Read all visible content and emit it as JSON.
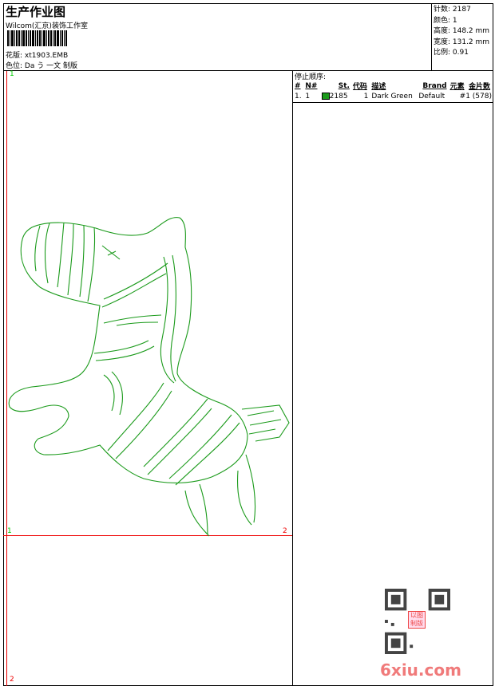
{
  "header": {
    "title": "生产作业图",
    "company": "Wilcom(汇京)装饰工作室",
    "design_label": "花版:",
    "design_value": "xt1903.EMB",
    "colorway_label": "色位:",
    "colorway_value": "Da う 一文 制版"
  },
  "stats": {
    "stitches": "针数: 2187",
    "colors": "颜色: 1",
    "height": "高度: 148.2 mm",
    "width": "宽度: 131.2 mm",
    "scale": "比例: 0.91"
  },
  "stop_sequence": {
    "label": "停止顺序:",
    "columns": [
      "#",
      "N#",
      "St.",
      "代码",
      "描述",
      "Brand",
      "元素",
      "金片数"
    ],
    "rows": [
      {
        "num": "1.",
        "needle": "1",
        "color": "#1a9a1a",
        "stitches": "2185",
        "code": "1",
        "description": "Dark Green",
        "brand": "Default",
        "elements": "#1 (578)"
      }
    ]
  },
  "markers": {
    "top_left": "1",
    "bottom_left": "1",
    "bottom_right": "2",
    "page2_left": "2"
  },
  "watermark": {
    "text": "6xiu.com",
    "seal": "以图制版"
  },
  "colors": {
    "thread": "#1a9a1a",
    "guide": "#e00000"
  }
}
